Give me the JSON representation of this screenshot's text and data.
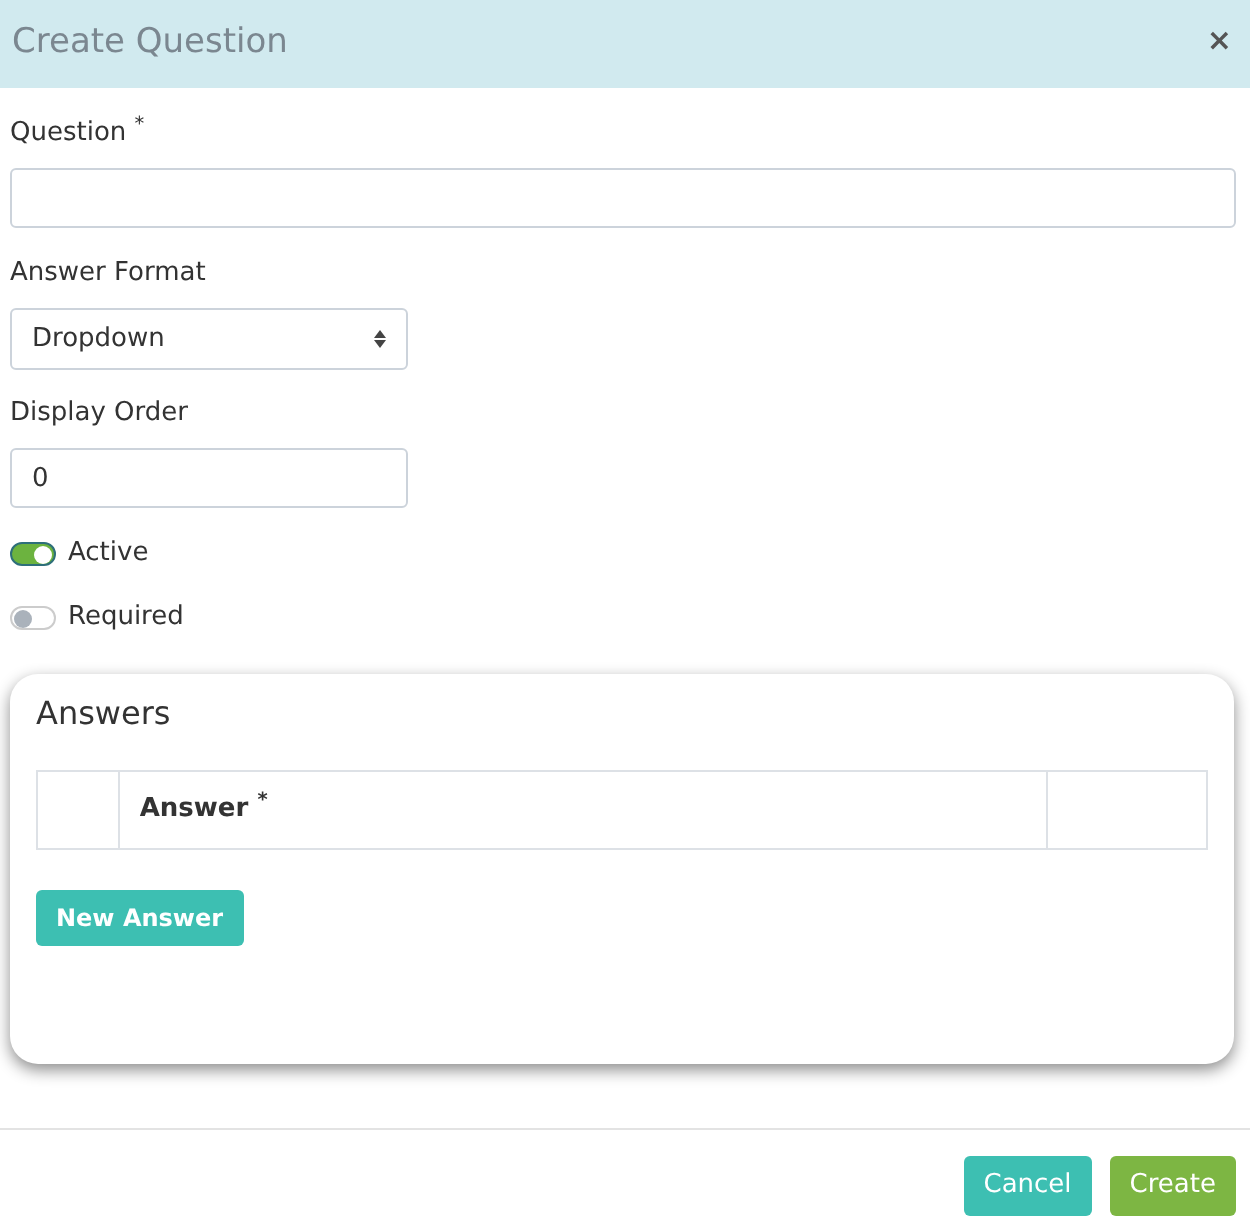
{
  "dialog": {
    "title": "Create Question",
    "close": "×"
  },
  "question": {
    "label": "Question $^{*}$"
  },
  "answer_format": {
    "label": "Answer Format",
    "value": "Dropdown"
  },
  "display_order": {
    "label": "Display Order",
    "value": "0"
  },
  "toggles": [
    {
      "label": "Active",
      "on": true
    },
    {
      "label": "Required",
      "on": false
    }
  ],
  "answers": {
    "title": "Answers",
    "columns": [
      {
        "kind": "blank"
      },
      {
        "kind": "text",
        "label": "Answer $^{*}$"
      },
      {
        "kind": "blank"
      }
    ],
    "button": "New Answer"
  },
  "footer": {
    "buttons": [
      {
        "kind": "cancel",
        "label": "Cancel"
      },
      {
        "kind": "create",
        "label": "Create"
      }
    ]
  }
}
